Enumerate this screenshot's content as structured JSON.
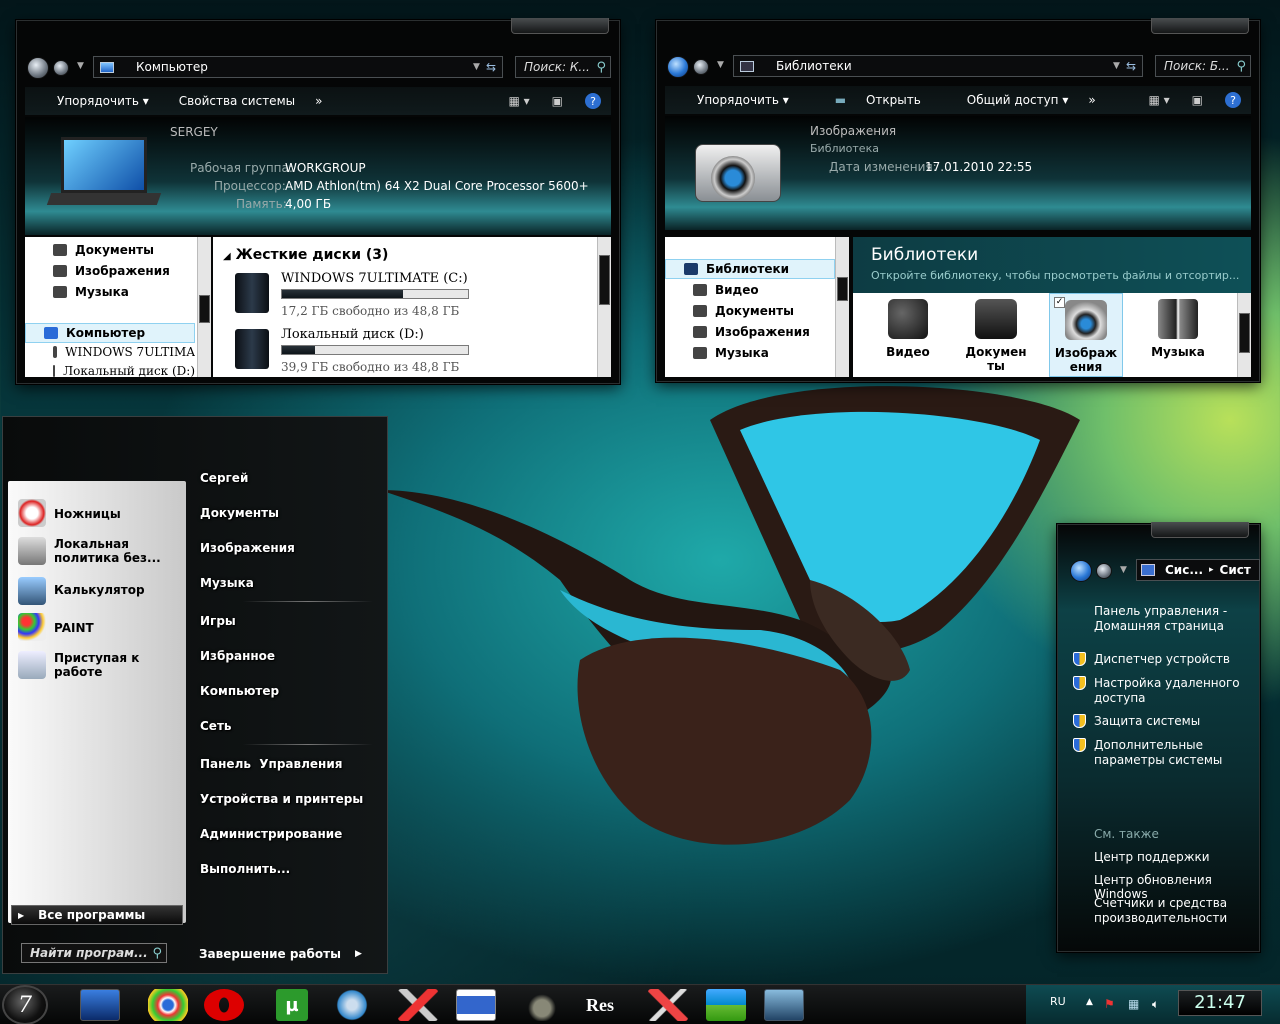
{
  "computer_window": {
    "address": "Компьютер",
    "search_placeholder": "Поиск: К...",
    "toolbar": {
      "organize": "Упорядочить",
      "system_props": "Свойства системы",
      "more": "»"
    },
    "details": {
      "name": "SERGEY",
      "workgroup_label": "Рабочая группа:",
      "workgroup": "WORKGROUP",
      "cpu_label": "Процессор:",
      "cpu": "AMD Athlon(tm) 64 X2 Dual Core Processor 5600+",
      "ram_label": "Память:",
      "ram": "4,00 ГБ"
    },
    "nav": [
      "Документы",
      "Изображения",
      "Музыка",
      "Компьютер",
      "WINDOWS 7ULTIMA",
      "Локальный диск (D:)"
    ],
    "group_header": "Жесткие диски (3)",
    "drives": [
      {
        "name": "WINDOWS 7ULTIMATE (C:)",
        "free": "17,2 ГБ свободно из 48,8 ГБ",
        "used_pct": 65
      },
      {
        "name": "Локальный диск (D:)",
        "free": "39,9 ГБ свободно из 48,8 ГБ",
        "used_pct": 18
      }
    ]
  },
  "libraries_window": {
    "address": "Библиотеки",
    "search_placeholder": "Поиск: Б...",
    "toolbar": {
      "organize": "Упорядочить",
      "open": "Открыть",
      "share": "Общий доступ",
      "more": "»"
    },
    "details": {
      "name": "Изображения",
      "type": "Библиотека",
      "date_label": "Дата изменения:",
      "date": "17.01.2010 22:55"
    },
    "nav": [
      "Библиотеки",
      "Видео",
      "Документы",
      "Изображения",
      "Музыка"
    ],
    "header_title": "Библиотеки",
    "header_sub": "Откройте библиотеку, чтобы просмотреть файлы и отсортир...",
    "tiles": [
      {
        "line1": "Видео",
        "line2": ""
      },
      {
        "line1": "Докумен",
        "line2": "ты"
      },
      {
        "line1": "Изображ",
        "line2": "ения"
      },
      {
        "line1": "Музыка",
        "line2": ""
      }
    ]
  },
  "start_menu": {
    "programs": [
      {
        "line1": "Ножницы",
        "line2": ""
      },
      {
        "line1": "Локальная",
        "line2": "политика без..."
      },
      {
        "line1": "Калькулятор",
        "line2": ""
      },
      {
        "line1": "PAINT",
        "line2": ""
      },
      {
        "line1": "Приступая к",
        "line2": "работе"
      }
    ],
    "all_programs": "Все программы",
    "search_placeholder": "Найти програм...",
    "right": [
      "Сергей",
      "Документы",
      "Изображения",
      "Музыка",
      "Игры",
      "Избранное",
      "Компьютер",
      "Сеть",
      "Панель  Управления",
      "Устройства и принтеры",
      "Администрирование",
      "Выполнить..."
    ],
    "shutdown": "Завершение работы"
  },
  "cp_window": {
    "address1": "Сис...",
    "address2": "Сист",
    "home_link_1": "Панель управления -",
    "home_link_2": "Домашняя страница",
    "links": [
      {
        "line1": "Диспетчер устройств",
        "line2": ""
      },
      {
        "line1": "Настройка удаленного",
        "line2": "доступа"
      },
      {
        "line1": "Защита системы",
        "line2": ""
      },
      {
        "line1": "Дополнительные",
        "line2": "параметры системы"
      }
    ],
    "see_also": "См. также",
    "see_also_links": [
      {
        "line1": "Центр поддержки",
        "line2": ""
      },
      {
        "line1": "Центр обновления Windows",
        "line2": ""
      },
      {
        "line1": "Счетчики и средства",
        "line2": "производительности"
      }
    ]
  },
  "taskbar": {
    "lang": "RU",
    "clock": "21:47",
    "res_label": "Res"
  }
}
